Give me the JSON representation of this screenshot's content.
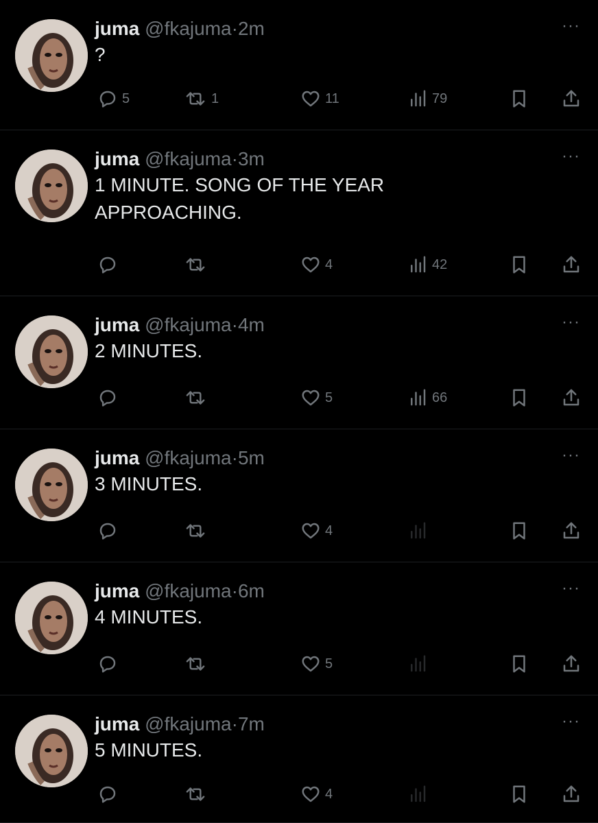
{
  "tweets": [
    {
      "name": "juma",
      "handle": "@fkajuma",
      "separator": "·",
      "time": "2m",
      "text": "?",
      "more": "···",
      "replies": "5",
      "retweets": "1",
      "likes": "11",
      "views": "79"
    },
    {
      "name": "juma",
      "handle": "@fkajuma",
      "separator": "·",
      "time": "3m",
      "text": "1 MINUTE. SONG OF THE YEAR APPROACHING.",
      "more": "···",
      "replies": "",
      "retweets": "",
      "likes": "4",
      "views": "42"
    },
    {
      "name": "juma",
      "handle": "@fkajuma",
      "separator": "·",
      "time": "4m",
      "text": "2 MINUTES.",
      "more": "···",
      "replies": "",
      "retweets": "",
      "likes": "5",
      "views": "66"
    },
    {
      "name": "juma",
      "handle": "@fkajuma",
      "separator": "·",
      "time": "5m",
      "text": "3 MINUTES.",
      "more": "···",
      "replies": "",
      "retweets": "",
      "likes": "4",
      "views": ""
    },
    {
      "name": "juma",
      "handle": "@fkajuma",
      "separator": "·",
      "time": "6m",
      "text": "4 MINUTES.",
      "more": "···",
      "replies": "",
      "retweets": "",
      "likes": "5",
      "views": ""
    },
    {
      "name": "juma",
      "handle": "@fkajuma",
      "separator": "·",
      "time": "7m",
      "text": "5 MINUTES.",
      "more": "···",
      "replies": "",
      "retweets": "",
      "likes": "4",
      "views": ""
    }
  ],
  "colors": {
    "background": "#000000",
    "text": "#e7e9ea",
    "muted": "#71767b"
  },
  "icons": [
    "reply-icon",
    "retweet-icon",
    "like-icon",
    "views-icon",
    "bookmark-icon",
    "share-icon",
    "more-icon"
  ]
}
